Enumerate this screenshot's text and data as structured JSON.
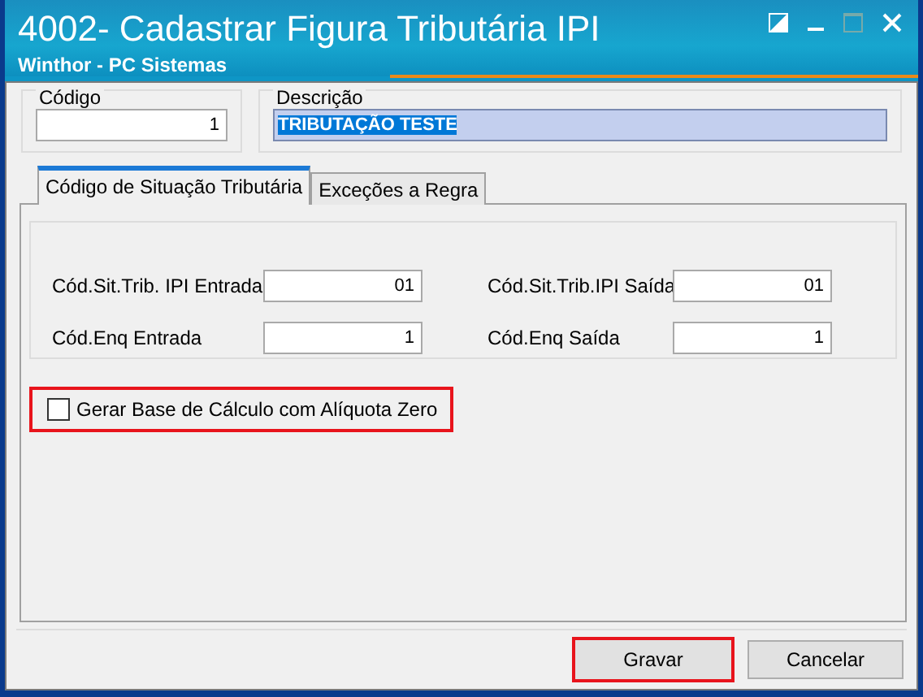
{
  "window": {
    "title": "4002- Cadastrar Figura Tributária IPI",
    "subtitle": "Winthor - PC Sistemas"
  },
  "header_fields": [
    {
      "label": "Código",
      "value": "1",
      "kind": "code"
    },
    {
      "label": "Descrição",
      "value": "TRIBUTAÇÃO TESTE",
      "kind": "description",
      "selected": true
    }
  ],
  "tabs": [
    {
      "label": "Código de Situação Tributária",
      "selected": true
    },
    {
      "label": "Exceções a Regra",
      "selected": false
    }
  ],
  "fields": [
    {
      "label": "Cód.Sit.Trib. IPI Entrada",
      "value": "01"
    },
    {
      "label": "Cód.Sit.Trib.IPI Saída",
      "value": "01"
    },
    {
      "label": "Cód.Enq Entrada",
      "value": "1"
    },
    {
      "label": "Cód.Enq Saída",
      "value": "1"
    }
  ],
  "checkbox": {
    "label": "Gerar Base de Cálculo com Alíquota Zero",
    "checked": false,
    "highlighted": true
  },
  "buttons": [
    {
      "label": "Gravar",
      "highlighted": true
    },
    {
      "label": "Cancelar",
      "highlighted": false
    }
  ]
}
